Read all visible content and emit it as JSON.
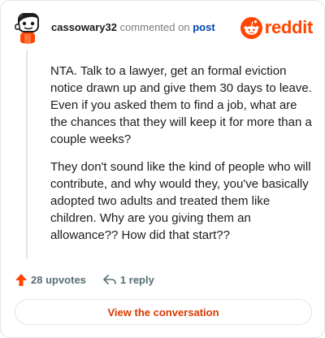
{
  "header": {
    "username": "cassowary32",
    "action": "commented on",
    "post_link": "post",
    "brand": "reddit",
    "avatar_icon": "snoo-avatar-icon",
    "brand_icon": "reddit-logo-icon"
  },
  "comment": {
    "paragraphs": [
      "NTA. Talk to a lawyer, get an formal eviction notice drawn up and give them 30 days to leave. Even if you asked them to find a job, what are the chances that they will keep it for more than a couple weeks?",
      "They don't sound like the kind of people who will contribute, and why would they, you've basically adopted two adults and treated them like children. Why are you giving them an allowance?? How did that start??"
    ]
  },
  "footer": {
    "upvotes": "28 upvotes",
    "replies": "1 reply",
    "upvote_icon": "upvote-arrow-icon",
    "reply_icon": "reply-arrow-icon"
  },
  "cta": {
    "label": "View the conversation"
  },
  "colors": {
    "brand": "#ff4500",
    "link": "#0045ac",
    "cta_text": "#d93900",
    "muted": "#576f76"
  }
}
